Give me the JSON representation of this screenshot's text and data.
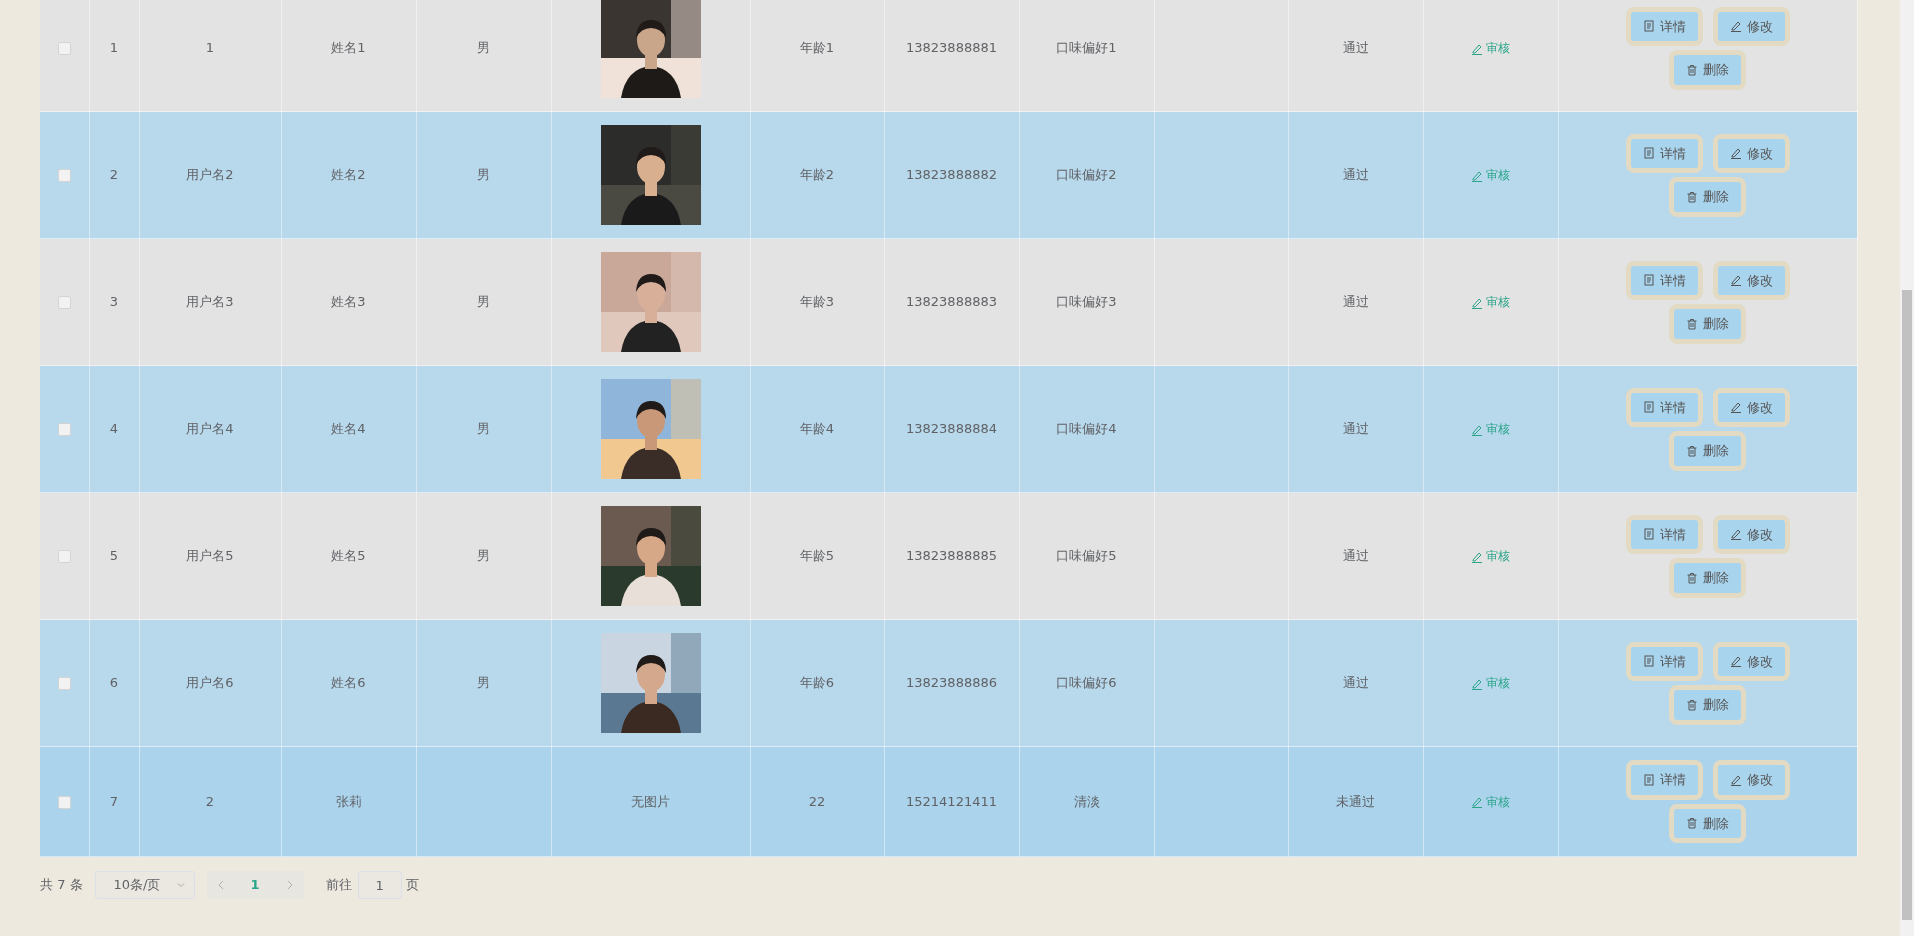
{
  "table": {
    "rows": [
      {
        "checked": false,
        "highlighted": false,
        "index": "1",
        "username": "1",
        "name": "姓名1",
        "gender": "男",
        "age": "年龄1",
        "phone": "13823888881",
        "taste": "口味偏好1",
        "status": "通过",
        "review": "审核",
        "actions": [
          "详情",
          "修改",
          "删除"
        ]
      },
      {
        "checked": false,
        "highlighted": false,
        "index": "2",
        "username": "用户名2",
        "name": "姓名2",
        "gender": "男",
        "age": "年龄2",
        "phone": "13823888882",
        "taste": "口味偏好2",
        "status": "通过",
        "review": "审核",
        "actions": [
          "详情",
          "修改",
          "删除"
        ]
      },
      {
        "checked": false,
        "highlighted": false,
        "index": "3",
        "username": "用户名3",
        "name": "姓名3",
        "gender": "男",
        "age": "年龄3",
        "phone": "13823888883",
        "taste": "口味偏好3",
        "status": "通过",
        "review": "审核",
        "actions": [
          "详情",
          "修改",
          "删除"
        ]
      },
      {
        "checked": false,
        "highlighted": false,
        "index": "4",
        "username": "用户名4",
        "name": "姓名4",
        "gender": "男",
        "age": "年龄4",
        "phone": "13823888884",
        "taste": "口味偏好4",
        "status": "通过",
        "review": "审核",
        "actions": [
          "详情",
          "修改",
          "删除"
        ]
      },
      {
        "checked": false,
        "highlighted": false,
        "index": "5",
        "username": "用户名5",
        "name": "姓名5",
        "gender": "男",
        "age": "年龄5",
        "phone": "13823888885",
        "taste": "口味偏好5",
        "status": "通过",
        "review": "审核",
        "actions": [
          "详情",
          "修改",
          "删除"
        ]
      },
      {
        "checked": false,
        "highlighted": false,
        "index": "6",
        "username": "用户名6",
        "name": "姓名6",
        "gender": "男",
        "age": "年龄6",
        "phone": "13823888886",
        "taste": "口味偏好6",
        "status": "通过",
        "review": "审核",
        "actions": [
          "详情",
          "修改",
          "删除"
        ]
      },
      {
        "checked": false,
        "highlighted": true,
        "index": "7",
        "username": "2",
        "name": "张莉",
        "photo": {
          "kind": "text",
          "text": "无图片"
        },
        "age": "22",
        "phone": "15214121411",
        "taste": "清淡",
        "status": "未通过",
        "review": "审核",
        "actions": [
          "详情",
          "修改",
          "删除"
        ]
      }
    ]
  },
  "pagination": {
    "total": "共 7 条",
    "page_size": "10条/页",
    "pages": [
      {
        "label": "1",
        "selected": true
      }
    ],
    "goto_label": "前往",
    "goto_value": "1",
    "goto_suffix": "页"
  }
}
